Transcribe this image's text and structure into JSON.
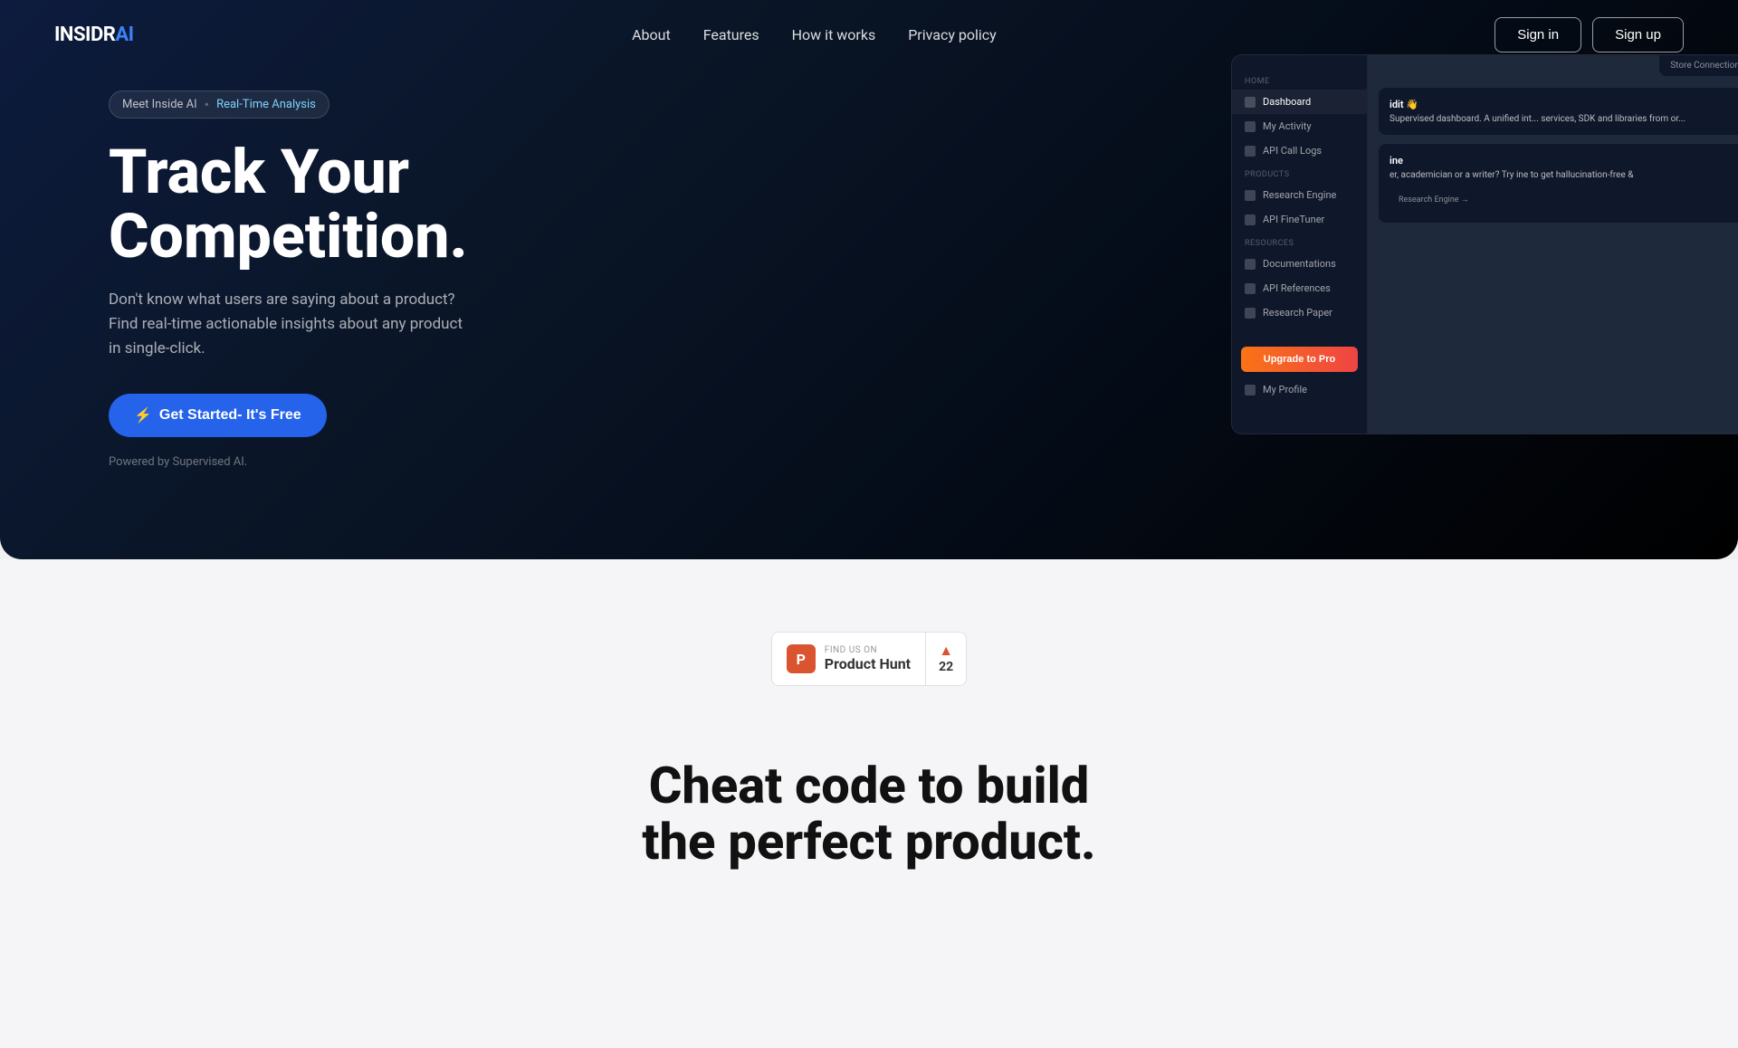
{
  "brand": {
    "logo": "INSIDRAI",
    "logo_display": "INSIDR"
  },
  "nav": {
    "links": [
      {
        "label": "About",
        "href": "#"
      },
      {
        "label": "Features",
        "href": "#"
      },
      {
        "label": "How it works",
        "href": "#"
      },
      {
        "label": "Privacy policy",
        "href": "#"
      }
    ],
    "signin": "Sign in",
    "signup": "Sign up"
  },
  "hero": {
    "badge_prefix": "Meet Inside AI",
    "badge_highlight": "Real-Time Analysis",
    "title_line1": "Track Your",
    "title_line2": "Competition.",
    "description": "Don't know what users are saying about a product? Find real-time actionable insights about any product in single-click.",
    "cta_icon": "⚡",
    "cta_label": "Get Started- It's Free",
    "powered_by": "Powered by Supervised AI."
  },
  "mockup": {
    "home_label": "HOME",
    "dashboard": "Dashboard",
    "my_activity": "My Activity",
    "api_call_logs": "API Call Logs",
    "products_label": "PRODUCTS",
    "research_engine": "Research Engine",
    "api_fine_tuner": "API FineTuner",
    "resources_label": "RESOURCES",
    "documentations": "Documentations",
    "api_references": "API References",
    "research_paper": "Research Paper",
    "upgrade_label": "Upgrade to Pro",
    "my_profile": "My Profile",
    "connections_label": "Store  Connections",
    "card_title": "idit 👋",
    "card_text": "Supervised dashboard. A unified int... services, SDK and libraries from or...",
    "card2_label": "ine",
    "card2_text": "er, academician or a writer? Try ine to get hallucination-free &",
    "research_engine_link": "Research Engine →"
  },
  "product_hunt": {
    "find_us": "FIND US ON",
    "title": "Product Hunt",
    "logo_letter": "P",
    "arrow": "▲",
    "count": "22"
  },
  "bottom": {
    "title_line1": "Cheat code to build",
    "title_line2": "the perfect product."
  }
}
